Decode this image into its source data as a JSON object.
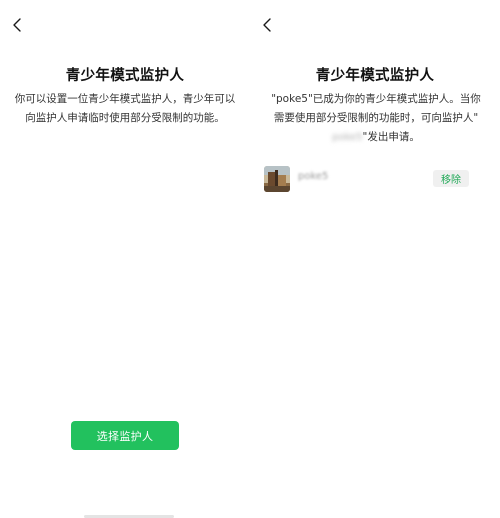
{
  "left_screen": {
    "title": "青少年模式监护人",
    "description": "你可以设置一位青少年模式监护人，青少年可以向监护人申请临时使用部分受限制的功能。",
    "select_button_label": "选择监护人"
  },
  "right_screen": {
    "title": "青少年模式监护人",
    "description_part1": "\"poke5\"已成为你的青少年模式监护人。当你需要使用部分受限制的功能时，可向监护人\"",
    "blurred_name": "poke5",
    "description_part2": "\"发出申请。",
    "guardian": {
      "name": "poke5",
      "remove_label": "移除"
    }
  },
  "colors": {
    "accent": "#22c15e",
    "remove_text": "#20a957"
  }
}
